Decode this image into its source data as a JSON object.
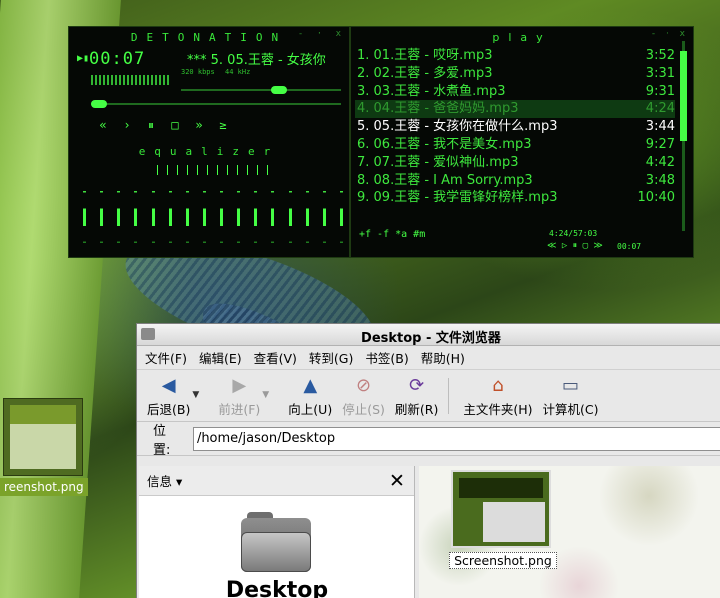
{
  "player": {
    "title": "DETONATION",
    "time": "00:07",
    "marquee": "*** 5. 05.王蓉 - 女孩你",
    "kbps": "320 kbps",
    "khz": "44 kHz",
    "play_indicator": "▶▮",
    "eq_title": "equalizer",
    "win_buttons": "- · x"
  },
  "playlist": {
    "title": "play",
    "items": [
      {
        "label": "1. 01.王蓉 - 哎呀.mp3",
        "duration": "3:52"
      },
      {
        "label": "2. 02.王蓉 - 多爱.mp3",
        "duration": "3:31"
      },
      {
        "label": "3. 03.王蓉 - 水煮鱼.mp3",
        "duration": "9:31"
      },
      {
        "label": "4. 04.王蓉 - 爸爸妈妈.mp3",
        "duration": "4:24"
      },
      {
        "label": "5. 05.王蓉 - 女孩你在做什么.mp3",
        "duration": "3:44"
      },
      {
        "label": "6. 06.王蓉 - 我不是美女.mp3",
        "duration": "9:27"
      },
      {
        "label": "7. 07.王蓉 - 爱似神仙.mp3",
        "duration": "4:42"
      },
      {
        "label": "8. 08.王蓉 - I Am Sorry.mp3",
        "duration": "3:48"
      },
      {
        "label": "9. 09.王蓉 - 我学雷锋好榜样.mp3",
        "duration": "10:40"
      }
    ],
    "selected_index": 3,
    "current_index": 4,
    "footer": "+f  -f  *a  #m",
    "info": "4:24/57:03",
    "mini_controls": "≪ ▷ ⏸ ▢ ≫",
    "mini_time": "00:07"
  },
  "desktop_icon": {
    "label": "reenshot.png"
  },
  "filebrowser": {
    "title": "Desktop - 文件浏览器",
    "menu": [
      "文件(F)",
      "编辑(E)",
      "查看(V)",
      "转到(G)",
      "书签(B)",
      "帮助(H)"
    ],
    "toolbar": {
      "back": "后退(B)",
      "forward": "前进(F)",
      "up": "向上(U)",
      "stop": "停止(S)",
      "refresh": "刷新(R)",
      "home": "主文件夹(H)",
      "computer": "计算机(C)"
    },
    "location_label": "位置:",
    "location_value": "/home/jason/Desktop",
    "sidebar_combo": "信息 ▾",
    "sidebar_folder_name": "Desktop",
    "file_label": "Screenshot.png"
  },
  "colors": {
    "player_green": "#45ff45",
    "player_bg": "#050805",
    "selected_row": "#0e3a12"
  }
}
